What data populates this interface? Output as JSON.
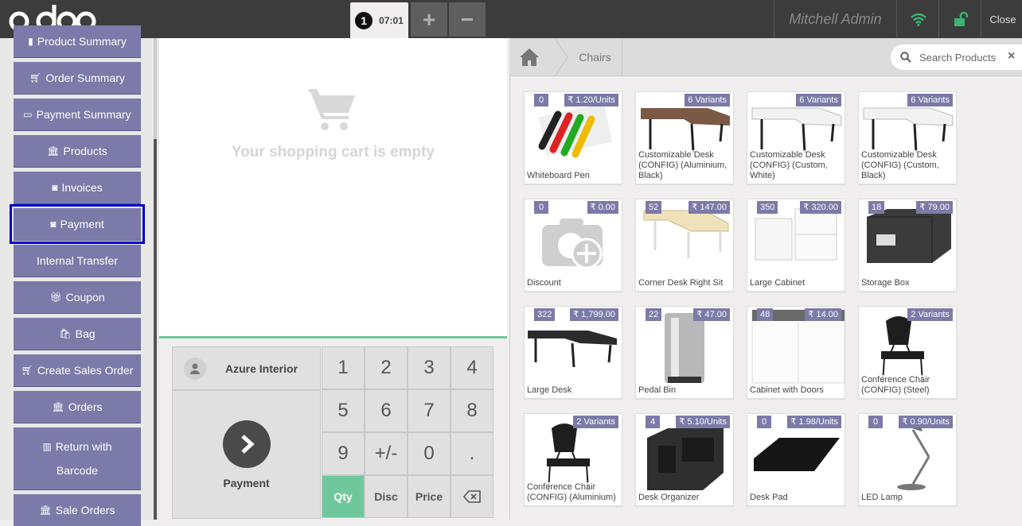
{
  "topbar": {
    "order_number": "1",
    "order_time": "07:01",
    "add_label": "+",
    "remove_label": "−",
    "user": "Mitchell Admin",
    "close_label": "Close",
    "brand_color": "#3c3c3c"
  },
  "control_buttons": [
    {
      "label": "Product Summary",
      "icon": "document-icon"
    },
    {
      "label": "Order Summary",
      "icon": "cart-icon"
    },
    {
      "label": "Payment Summary",
      "icon": "credit-card-icon"
    },
    {
      "label": "Products",
      "icon": "bank-icon"
    },
    {
      "label": "Invoices",
      "icon": "money-icon"
    },
    {
      "label": "Payment",
      "icon": "money-icon",
      "selected": true
    },
    {
      "label": "Internal Transfer",
      "icon": ""
    },
    {
      "label": "Coupon",
      "icon": "gift-icon"
    },
    {
      "label": "Bag",
      "icon": "bag-icon"
    },
    {
      "label": "Create Sales Order",
      "icon": "cart-icon"
    },
    {
      "label": "Orders",
      "icon": "bank-icon"
    },
    {
      "label": "Return with",
      "label2": "Barcode",
      "icon": "barcode-icon"
    },
    {
      "label": "Sale Orders",
      "icon": "bank-icon"
    }
  ],
  "order": {
    "empty_message": "Your shopping cart is empty"
  },
  "actionpad": {
    "customer": "Azure Interior",
    "payment_label": "Payment"
  },
  "numpad": {
    "keys": [
      "1",
      "2",
      "3",
      "4",
      "5",
      "6",
      "7",
      "8",
      "9",
      "+/-",
      "0",
      "."
    ],
    "modes": [
      "Qty",
      "Disc",
      "Price"
    ],
    "active_mode": "Qty",
    "accent_color": "#6ec89b"
  },
  "breadcrumb": {
    "category": "Chairs"
  },
  "search": {
    "placeholder": "Search Products",
    "clear": "×"
  },
  "products": [
    {
      "name": "Whiteboard Pen",
      "qty": "0",
      "price": "₹ 1.20/Units",
      "img": "pens"
    },
    {
      "name": "Customizable Desk (CONFIG) (Aluminium, Black)",
      "qty": "",
      "price": "6 Variants",
      "img": "desk-brown"
    },
    {
      "name": "Customizable Desk (CONFIG) (Custom, White)",
      "qty": "",
      "price": "6 Variants",
      "img": "desk-white"
    },
    {
      "name": "Customizable Desk (CONFIG) (Custom, Black)",
      "qty": "",
      "price": "6 Variants",
      "img": "desk-white"
    },
    {
      "name": "Discount",
      "qty": "0",
      "price": "₹ 0.00",
      "img": "placeholder"
    },
    {
      "name": "Corner Desk Right Sit",
      "qty": "52",
      "price": "₹ 147.00",
      "img": "corner-desk"
    },
    {
      "name": "Large Cabinet",
      "qty": "350",
      "price": "₹ 320.00",
      "img": "cabinet"
    },
    {
      "name": "Storage Box",
      "qty": "18",
      "price": "₹ 79.00",
      "img": "box"
    },
    {
      "name": "Large Desk",
      "qty": "322",
      "price": "₹ 1,799.00",
      "img": "large-desk"
    },
    {
      "name": "Pedal Bin",
      "qty": "22",
      "price": "₹ 47.00",
      "img": "bin"
    },
    {
      "name": "Cabinet with Doors",
      "qty": "48",
      "price": "₹ 14.00",
      "img": "cabinet-doors"
    },
    {
      "name": "Conference Chair (CONFIG) (Steel)",
      "qty": "",
      "price": "2 Variants",
      "img": "chair"
    },
    {
      "name": "Conference Chair (CONFIG) (Aluminium)",
      "qty": "",
      "price": "2 Variants",
      "img": "chair"
    },
    {
      "name": "Desk Organizer",
      "qty": "4",
      "price": "₹ 5.10/Units",
      "img": "organizer"
    },
    {
      "name": "Desk Pad",
      "qty": "0",
      "price": "₹ 1.98/Units",
      "img": "pad"
    },
    {
      "name": "LED Lamp",
      "qty": "0",
      "price": "₹ 0.90/Units",
      "img": "lamp"
    }
  ]
}
